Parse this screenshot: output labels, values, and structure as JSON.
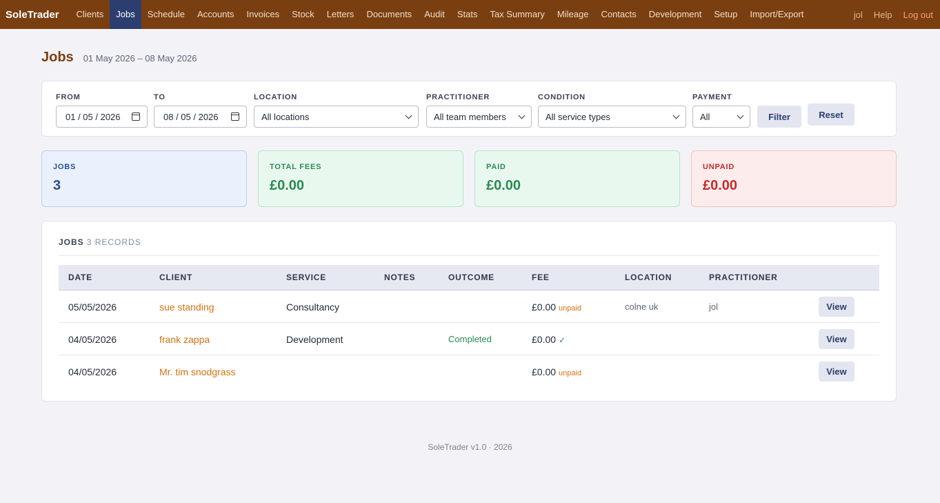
{
  "nav": {
    "brand": "SoleTrader",
    "items": [
      "Clients",
      "Jobs",
      "Schedule",
      "Accounts",
      "Invoices",
      "Stock",
      "Letters",
      "Documents",
      "Audit",
      "Stats",
      "Tax Summary",
      "Mileage",
      "Contacts",
      "Development",
      "Setup",
      "Import/Export"
    ],
    "active": "Jobs",
    "user": "jol",
    "help": "Help",
    "logout": "Log out"
  },
  "page": {
    "title": "Jobs",
    "range": "01 May 2026 – 08 May 2026"
  },
  "filters": {
    "from_label": "FROM",
    "from_value": "01 / 05 / 2026",
    "to_label": "TO",
    "to_value": "08 / 05 / 2026",
    "location_label": "LOCATION",
    "location_value": "All locations",
    "practitioner_label": "PRACTITIONER",
    "practitioner_value": "All team members",
    "condition_label": "CONDITION",
    "condition_value": "All service types",
    "payment_label": "PAYMENT",
    "payment_value": "All",
    "filter_button": "Filter",
    "reset_button": "Reset"
  },
  "stats": {
    "jobs_label": "JOBS",
    "jobs_value": "3",
    "fees_label": "TOTAL FEES",
    "fees_value": "£0.00",
    "paid_label": "PAID",
    "paid_value": "£0.00",
    "unpaid_label": "UNPAID",
    "unpaid_value": "£0.00"
  },
  "table": {
    "title": "JOBS",
    "records": "3 RECORDS",
    "columns": [
      "DATE",
      "CLIENT",
      "SERVICE",
      "NOTES",
      "OUTCOME",
      "FEE",
      "LOCATION",
      "PRACTITIONER"
    ],
    "rows": [
      {
        "date": "05/05/2026",
        "client": "sue standing",
        "service": "Consultancy",
        "notes": "",
        "outcome": "",
        "fee": "£0.00",
        "fee_status": "unpaid",
        "location": "colne uk",
        "practitioner": "jol",
        "action": "View"
      },
      {
        "date": "04/05/2026",
        "client": "frank zappa",
        "service": "Development",
        "notes": "",
        "outcome": "Completed",
        "fee": "£0.00",
        "fee_status": "✓",
        "location": "",
        "practitioner": "",
        "action": "View"
      },
      {
        "date": "04/05/2026",
        "client": "Mr. tim snodgrass",
        "service": "",
        "notes": "",
        "outcome": "",
        "fee": "£0.00",
        "fee_status": "unpaid",
        "location": "",
        "practitioner": "",
        "action": "View"
      }
    ]
  },
  "footer": "SoleTrader v1.0 · 2026"
}
